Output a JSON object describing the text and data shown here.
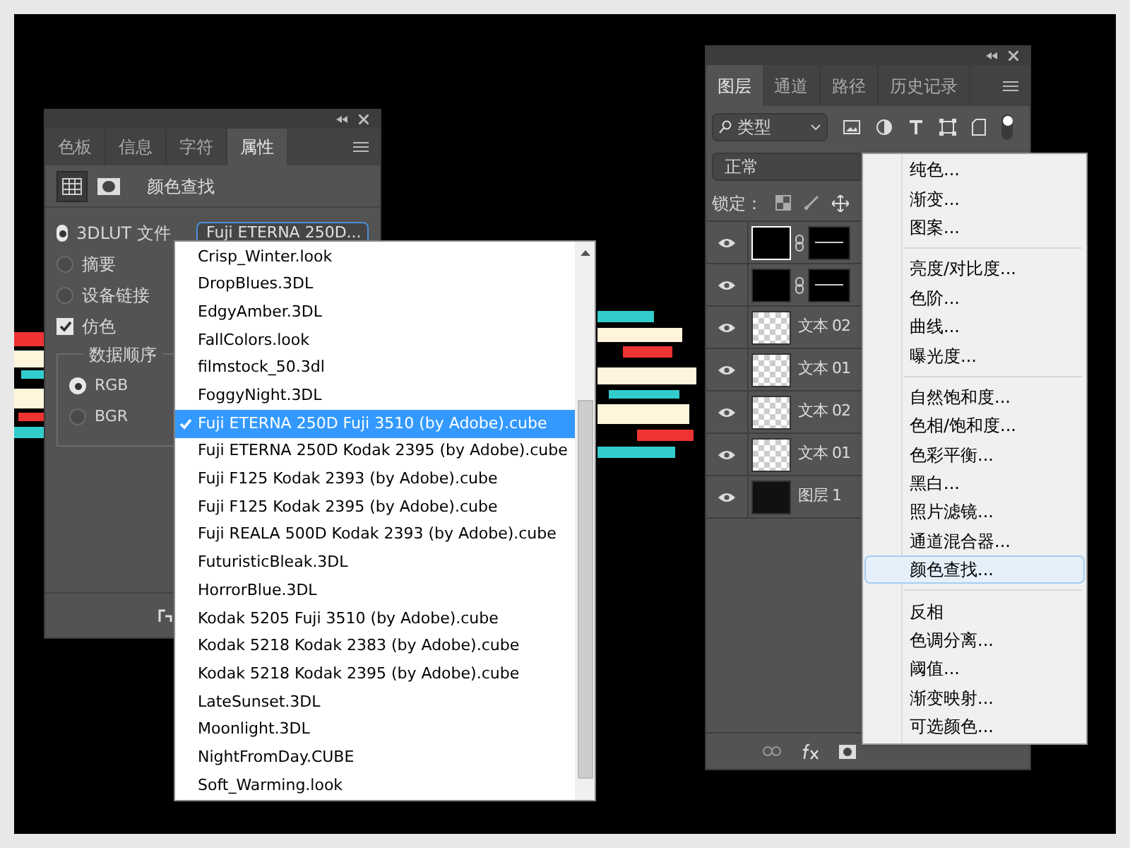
{
  "properties_panel": {
    "tabs": [
      {
        "label": "色板",
        "selected": false
      },
      {
        "label": "信息",
        "selected": false
      },
      {
        "label": "字符",
        "selected": false
      },
      {
        "label": "属性",
        "selected": true
      }
    ],
    "title": "颜色查找",
    "options": [
      {
        "kind": "radio",
        "label": "3DLUT 文件",
        "selected": true,
        "value": "Fuji ETERNA 250D..."
      },
      {
        "kind": "radio",
        "label": "摘要",
        "selected": false
      },
      {
        "kind": "radio",
        "label": "设备链接",
        "selected": false
      },
      {
        "kind": "checkbox",
        "label": "仿色",
        "checked": true
      }
    ],
    "data_order": {
      "title": "数据顺序",
      "options": [
        {
          "label": "RGB",
          "selected": true
        },
        {
          "label": "BGR",
          "selected": false
        }
      ]
    }
  },
  "lut_list": {
    "items": [
      {
        "label": "Crisp_Winter.look",
        "selected": false
      },
      {
        "label": "DropBlues.3DL",
        "selected": false
      },
      {
        "label": "EdgyAmber.3DL",
        "selected": false
      },
      {
        "label": "FallColors.look",
        "selected": false
      },
      {
        "label": "filmstock_50.3dl",
        "selected": false
      },
      {
        "label": "FoggyNight.3DL",
        "selected": false
      },
      {
        "label": "Fuji ETERNA 250D Fuji 3510 (by Adobe).cube",
        "selected": true
      },
      {
        "label": "Fuji ETERNA 250D Kodak 2395 (by Adobe).cube",
        "selected": false
      },
      {
        "label": "Fuji F125 Kodak 2393 (by Adobe).cube",
        "selected": false
      },
      {
        "label": "Fuji F125 Kodak 2395 (by Adobe).cube",
        "selected": false
      },
      {
        "label": "Fuji REALA 500D Kodak 2393 (by Adobe).cube",
        "selected": false
      },
      {
        "label": "FuturisticBleak.3DL",
        "selected": false
      },
      {
        "label": "HorrorBlue.3DL",
        "selected": false
      },
      {
        "label": "Kodak 5205 Fuji 3510 (by Adobe).cube",
        "selected": false
      },
      {
        "label": "Kodak 5218 Kodak 2383 (by Adobe).cube",
        "selected": false
      },
      {
        "label": "Kodak 5218 Kodak 2395 (by Adobe).cube",
        "selected": false
      },
      {
        "label": "LateSunset.3DL",
        "selected": false
      },
      {
        "label": "Moonlight.3DL",
        "selected": false
      },
      {
        "label": "NightFromDay.CUBE",
        "selected": false
      },
      {
        "label": "Soft_Warming.look",
        "selected": false
      }
    ]
  },
  "layers_panel": {
    "tabs": [
      {
        "label": "图层",
        "selected": true
      },
      {
        "label": "通道",
        "selected": false
      },
      {
        "label": "路径",
        "selected": false
      },
      {
        "label": "历史记录",
        "selected": false
      }
    ],
    "filter": "类型",
    "blend_mode": "正常",
    "lock_label": "锁定：",
    "layers": [
      {
        "kind": "masked",
        "selected": true
      },
      {
        "kind": "masked",
        "selected": false
      },
      {
        "kind": "smart",
        "name": "文本 02",
        "selected": false
      },
      {
        "kind": "smart",
        "name": "文本 01",
        "selected": false
      },
      {
        "kind": "smart",
        "name": "文本 02",
        "selected": false
      },
      {
        "kind": "smart",
        "name": "文本 01",
        "selected": false
      },
      {
        "kind": "fill",
        "name": "图层 1",
        "selected": false
      }
    ]
  },
  "context_menu": {
    "groups": [
      [
        {
          "label": "纯色...",
          "selected": false
        },
        {
          "label": "渐变...",
          "selected": false
        },
        {
          "label": "图案...",
          "selected": false
        }
      ],
      [
        {
          "label": "亮度/对比度...",
          "selected": false
        },
        {
          "label": "色阶...",
          "selected": false
        },
        {
          "label": "曲线...",
          "selected": false
        },
        {
          "label": "曝光度...",
          "selected": false
        }
      ],
      [
        {
          "label": "自然饱和度...",
          "selected": false
        },
        {
          "label": "色相/饱和度...",
          "selected": false
        },
        {
          "label": "色彩平衡...",
          "selected": false
        },
        {
          "label": "黑白...",
          "selected": false
        },
        {
          "label": "照片滤镜...",
          "selected": false
        },
        {
          "label": "通道混合器...",
          "selected": false
        },
        {
          "label": "颜色查找...",
          "selected": true
        }
      ],
      [
        {
          "label": "反相",
          "selected": false
        },
        {
          "label": "色调分离...",
          "selected": false
        },
        {
          "label": "阈值...",
          "selected": false
        },
        {
          "label": "渐变映射...",
          "selected": false
        },
        {
          "label": "可选颜色...",
          "selected": false
        }
      ]
    ]
  }
}
